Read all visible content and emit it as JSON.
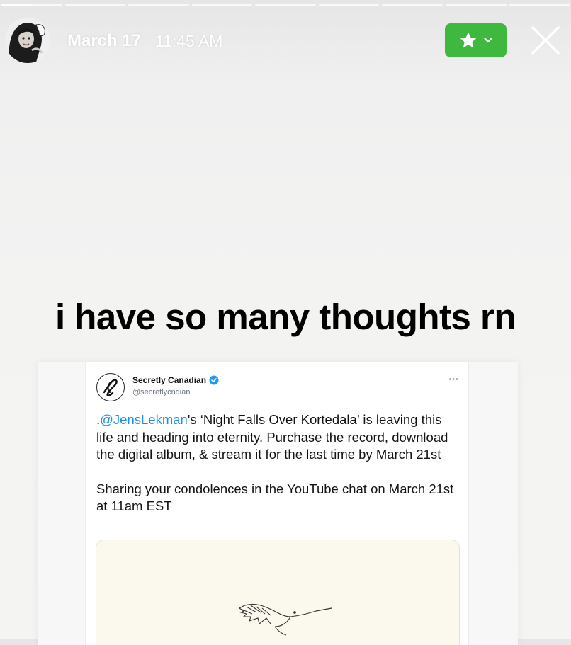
{
  "story": {
    "segment_count": 9,
    "current_segment_progress": 0.5
  },
  "header": {
    "date": "March 17",
    "time": "11:45 AM",
    "close_icon": "close-icon",
    "favorite_icon": "star-icon"
  },
  "caption": "i have so many thoughts rn",
  "tweet": {
    "account_name": "Secretly Canadian",
    "account_handle": "@secretlycndian",
    "more_label": "···",
    "mention": "@JensLekman",
    "text_prefix": ".",
    "text_rest": "'s ‘Night Falls Over Kortedala’ is leaving this life and heading into eternity. Purchase the record, download the digital album, & stream it for the last time by March 21st",
    "text_p2": "Sharing your condolences in the YouTube chat on March 21st at 11am EST",
    "media_icon": "hummingbird-illustration"
  },
  "colors": {
    "favorite_green": "#3fb83f",
    "mention_blue": "#1d8fe3",
    "verified_blue": "#1d9bf0"
  }
}
